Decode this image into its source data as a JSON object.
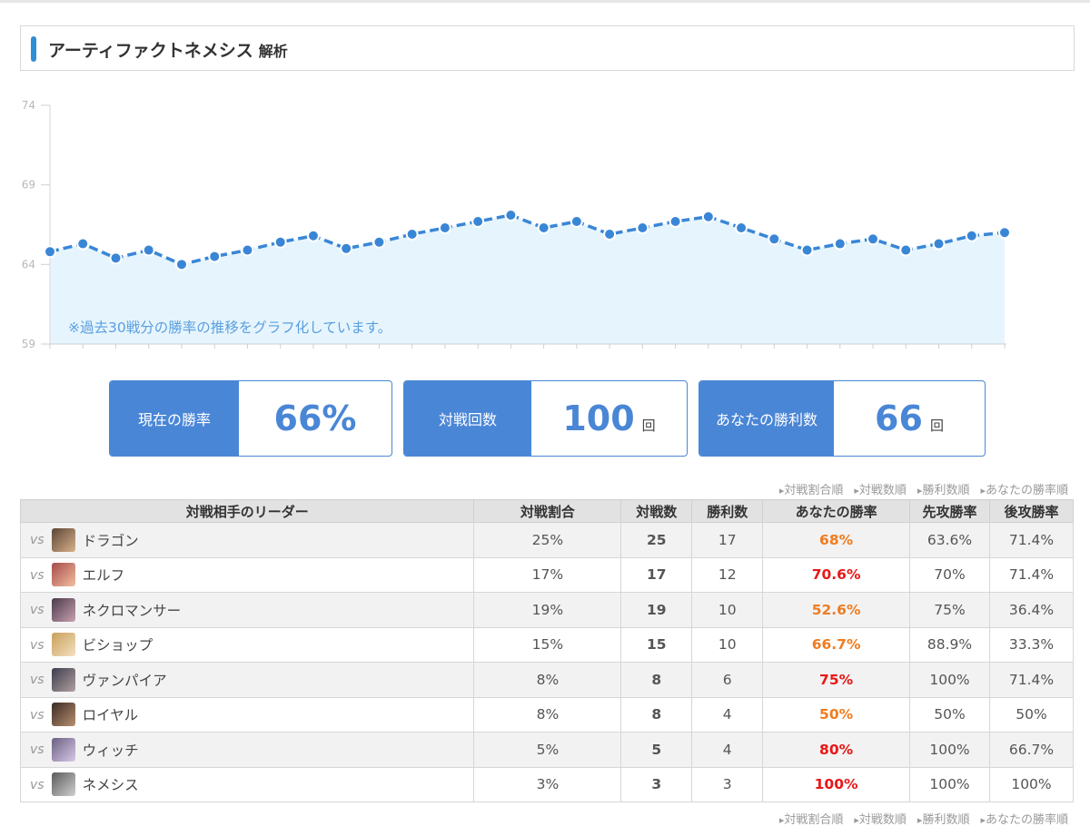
{
  "header": {
    "title": "アーティファクトネメシス",
    "subtitle": "解析"
  },
  "colors": {
    "accent": "#4a86d6",
    "line": "#3a86d6",
    "fill": "#e6f5fd",
    "rate_orange": "#f07c20",
    "rate_red": "#e81818"
  },
  "chart_data": {
    "type": "area",
    "title": "",
    "xlabel": "",
    "ylabel": "",
    "ylim": [
      59,
      74
    ],
    "yticks": [
      "74",
      "69",
      "64",
      "59"
    ],
    "grid": false,
    "note": "※過去30戦分の勝率の推移をグラフ化しています。",
    "series": [
      {
        "values": [
          64.8,
          65.3,
          64.4,
          64.9,
          64.0,
          64.5,
          64.9,
          65.4,
          65.8,
          65.0,
          65.4,
          65.9,
          66.3,
          66.7,
          67.1,
          66.3,
          66.7,
          65.9,
          66.3,
          66.7,
          67.0,
          66.3,
          65.6,
          64.9,
          65.3,
          65.6,
          64.9,
          65.3,
          65.8,
          66.0
        ]
      }
    ]
  },
  "stats": [
    {
      "label": "現在の勝率",
      "value": "66%",
      "unit": ""
    },
    {
      "label": "対戦回数",
      "value": "100",
      "unit": "回"
    },
    {
      "label": "あなたの勝利数",
      "value": "66",
      "unit": "回"
    }
  ],
  "sort_links": [
    "対戦割合順",
    "対戦数順",
    "勝利数順",
    "あなたの勝率順"
  ],
  "table": {
    "headers": [
      "対戦相手のリーダー",
      "対戦割合",
      "対戦数",
      "勝利数",
      "あなたの勝率",
      "先攻勝率",
      "後攻勝率"
    ],
    "vs_label": "vs",
    "rows": [
      {
        "leader": "ドラゴン",
        "share": "25%",
        "battles": "25",
        "wins": "17",
        "rate": "68%",
        "rate_color": "orange",
        "first": "63.6%",
        "second": "71.4%",
        "avatar": "dragon-avatar"
      },
      {
        "leader": "エルフ",
        "share": "17%",
        "battles": "17",
        "wins": "12",
        "rate": "70.6%",
        "rate_color": "red",
        "first": "70%",
        "second": "71.4%",
        "avatar": "elf-avatar"
      },
      {
        "leader": "ネクロマンサー",
        "share": "19%",
        "battles": "19",
        "wins": "10",
        "rate": "52.6%",
        "rate_color": "orange",
        "first": "75%",
        "second": "36.4%",
        "avatar": "necromancer-avatar"
      },
      {
        "leader": "ビショップ",
        "share": "15%",
        "battles": "15",
        "wins": "10",
        "rate": "66.7%",
        "rate_color": "orange",
        "first": "88.9%",
        "second": "33.3%",
        "avatar": "bishop-avatar"
      },
      {
        "leader": "ヴァンパイア",
        "share": "8%",
        "battles": "8",
        "wins": "6",
        "rate": "75%",
        "rate_color": "red",
        "first": "100%",
        "second": "71.4%",
        "avatar": "vampire-avatar"
      },
      {
        "leader": "ロイヤル",
        "share": "8%",
        "battles": "8",
        "wins": "4",
        "rate": "50%",
        "rate_color": "orange",
        "first": "50%",
        "second": "50%",
        "avatar": "royal-avatar"
      },
      {
        "leader": "ウィッチ",
        "share": "5%",
        "battles": "5",
        "wins": "4",
        "rate": "80%",
        "rate_color": "red",
        "first": "100%",
        "second": "66.7%",
        "avatar": "witch-avatar"
      },
      {
        "leader": "ネメシス",
        "share": "3%",
        "battles": "3",
        "wins": "3",
        "rate": "100%",
        "rate_color": "red",
        "first": "100%",
        "second": "100%",
        "avatar": "nemesis-avatar"
      }
    ]
  }
}
